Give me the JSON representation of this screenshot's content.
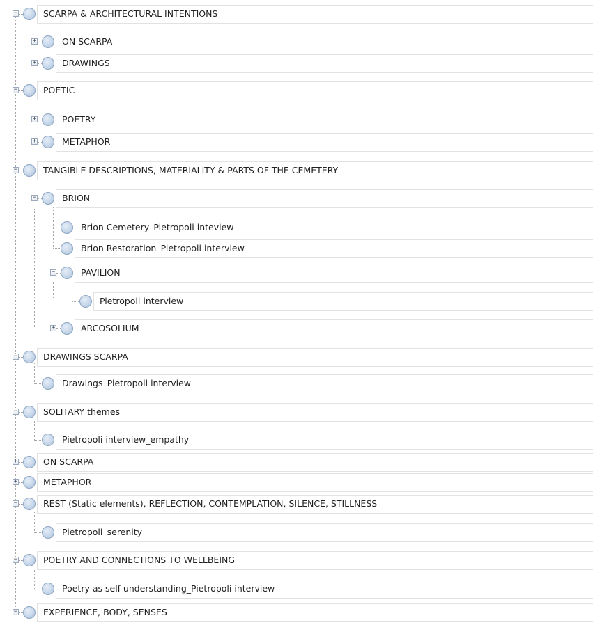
{
  "tree": {
    "rows": [
      {
        "label": "SCARPA & ARCHITECTURAL INTENTIONS",
        "level": 0,
        "toggle": "collapse"
      },
      {
        "label": "ON SCARPA",
        "level": 1,
        "toggle": "expand"
      },
      {
        "label": "DRAWINGS",
        "level": 1,
        "toggle": "expand"
      },
      {
        "label": "POETIC",
        "level": 0,
        "toggle": "collapse"
      },
      {
        "label": "POETRY",
        "level": 1,
        "toggle": "expand"
      },
      {
        "label": "METAPHOR",
        "level": 1,
        "toggle": "expand"
      },
      {
        "label": "TANGIBLE DESCRIPTIONS, MATERIALITY & PARTS OF THE CEMETERY",
        "level": 0,
        "toggle": "collapse"
      },
      {
        "label": "BRION",
        "level": 1,
        "toggle": "collapse"
      },
      {
        "label": "Brion Cemetery_Pietropoli inteview",
        "level": 2,
        "toggle": "none"
      },
      {
        "label": "Brion Restoration_Pietropoli interview",
        "level": 2,
        "toggle": "none"
      },
      {
        "label": "PAVILION",
        "level": 2,
        "toggle": "collapse"
      },
      {
        "label": "Pietropoli interview",
        "level": 3,
        "toggle": "none"
      },
      {
        "label": "ARCOSOLIUM",
        "level": 2,
        "toggle": "expand"
      },
      {
        "label": "DRAWINGS SCARPA",
        "level": 0,
        "toggle": "collapse"
      },
      {
        "label": "Drawings_Pietropoli interview",
        "level": 1,
        "toggle": "none"
      },
      {
        "label": "SOLITARY themes",
        "level": 0,
        "toggle": "collapse"
      },
      {
        "label": "Pietropoli interview_empathy",
        "level": 1,
        "toggle": "none"
      },
      {
        "label": "ON SCARPA",
        "level": 0,
        "toggle": "expand"
      },
      {
        "label": "METAPHOR",
        "level": 0,
        "toggle": "expand"
      },
      {
        "label": "REST (Static elements), REFLECTION, CONTEMPLATION, SILENCE, STILLNESS",
        "level": 0,
        "toggle": "collapse"
      },
      {
        "label": "Pietropoli_serenity",
        "level": 1,
        "toggle": "none"
      },
      {
        "label": "POETRY AND CONNECTIONS TO WELLBEING",
        "level": 0,
        "toggle": "collapse"
      },
      {
        "label": "Poetry as self-understanding_Pietropoli interview",
        "level": 1,
        "toggle": "none"
      },
      {
        "label": "EXPERIENCE, BODY, SENSES",
        "level": 0,
        "toggle": "collapse"
      }
    ]
  }
}
